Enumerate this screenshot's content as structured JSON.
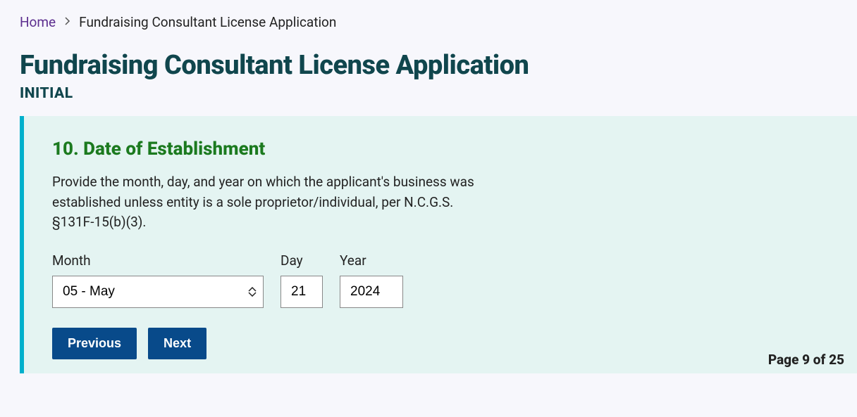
{
  "breadcrumb": {
    "home": "Home",
    "current": "Fundraising Consultant License Application"
  },
  "header": {
    "title": "Fundraising Consultant License Application",
    "subtitle": "INITIAL"
  },
  "section": {
    "heading": "10. Date of Establishment",
    "description": "Provide the month, day, and year on which the applicant's business was established unless entity is a sole proprietor/individual, per N.C.G.S. §131F-15(b)(3)."
  },
  "fields": {
    "month_label": "Month",
    "month_value": "05 - May",
    "day_label": "Day",
    "day_value": "21",
    "year_label": "Year",
    "year_value": "2024"
  },
  "buttons": {
    "previous": "Previous",
    "next": "Next"
  },
  "pagination": "Page 9 of 25"
}
